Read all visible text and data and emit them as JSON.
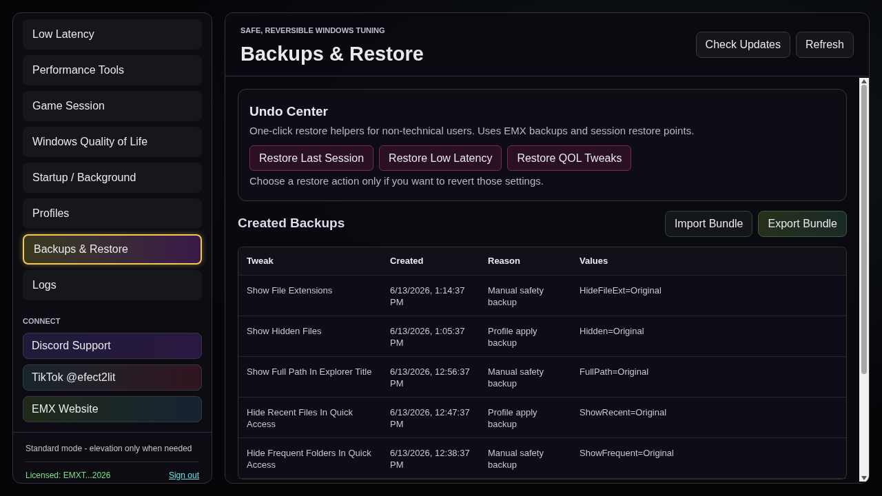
{
  "sidebar": {
    "items": [
      {
        "label": "Low Latency",
        "selected": false
      },
      {
        "label": "Performance Tools",
        "selected": false
      },
      {
        "label": "Game Session",
        "selected": false
      },
      {
        "label": "Windows Quality of Life",
        "selected": false
      },
      {
        "label": "Startup / Background",
        "selected": false
      },
      {
        "label": "Profiles",
        "selected": false
      },
      {
        "label": "Backups & Restore",
        "selected": true
      },
      {
        "label": "Logs",
        "selected": false
      }
    ],
    "connect_heading": "CONNECT",
    "connect_links": [
      "Discord Support",
      "TikTok @efect2lit",
      "EMX Website"
    ],
    "mode_note": "Standard mode - elevation only when needed",
    "license": "Licensed: EMXT...2026",
    "sign_out": "Sign out"
  },
  "header": {
    "eyebrow": "SAFE, REVERSIBLE WINDOWS TUNING",
    "title": "Backups & Restore",
    "buttons": [
      "Check Updates",
      "Refresh"
    ]
  },
  "undo_center": {
    "title": "Undo Center",
    "description": "One-click restore helpers for non-technical users. Uses EMX backups and session restore points.",
    "buttons": [
      "Restore Last Session",
      "Restore Low Latency",
      "Restore QOL Tweaks"
    ],
    "note": "Choose a restore action only if you want to revert those settings."
  },
  "backups": {
    "title": "Created Backups",
    "buttons": [
      "Import Bundle",
      "Export Bundle"
    ],
    "table": {
      "columns": [
        "Tweak",
        "Created",
        "Reason",
        "Values"
      ],
      "rows": [
        [
          "Show File Extensions",
          "6/13/2026, 1:14:37 PM",
          "Manual safety backup",
          "HideFileExt=Original"
        ],
        [
          "Show Hidden Files",
          "6/13/2026, 1:05:37 PM",
          "Profile apply backup",
          "Hidden=Original"
        ],
        [
          "Show Full Path In Explorer Title",
          "6/13/2026, 12:56:37 PM",
          "Manual safety backup",
          "FullPath=Original"
        ],
        [
          "Hide Recent Files In Quick Access",
          "6/13/2026, 12:47:37 PM",
          "Profile apply backup",
          "ShowRecent=Original"
        ],
        [
          "Hide Frequent Folders In Quick Access",
          "6/13/2026, 12:38:37 PM",
          "Manual safety backup",
          "ShowFrequent=Original"
        ]
      ]
    }
  }
}
